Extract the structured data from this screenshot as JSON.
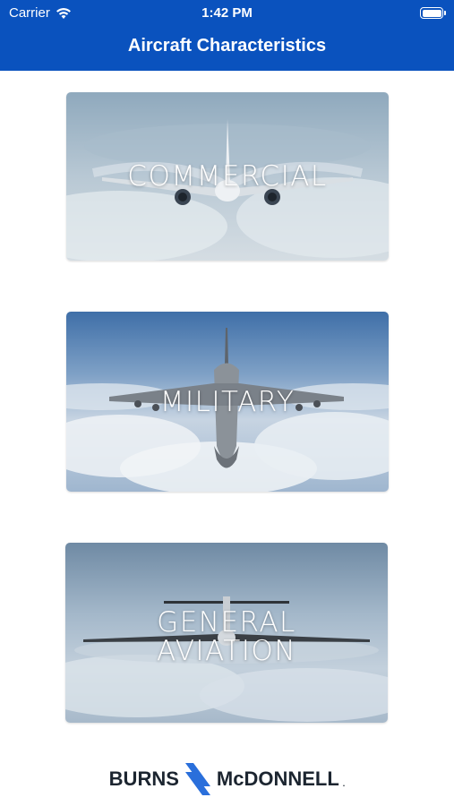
{
  "status_bar": {
    "carrier": "Carrier",
    "time": "1:42 PM"
  },
  "header": {
    "title": "Aircraft Characteristics"
  },
  "categories": [
    {
      "label": "COMMERCIAL"
    },
    {
      "label": "MILITARY"
    },
    {
      "label": "GENERAL AVIATION",
      "line1": "GENERAL",
      "line2": "AVIATION"
    }
  ],
  "footer": {
    "logo_left": "BURNS",
    "logo_right": "McDONNELL",
    "logo_mark": "."
  },
  "colors": {
    "header_bg": "#0a52be",
    "brand_blue": "#2a6fdb",
    "logo_text": "#1c2530"
  }
}
